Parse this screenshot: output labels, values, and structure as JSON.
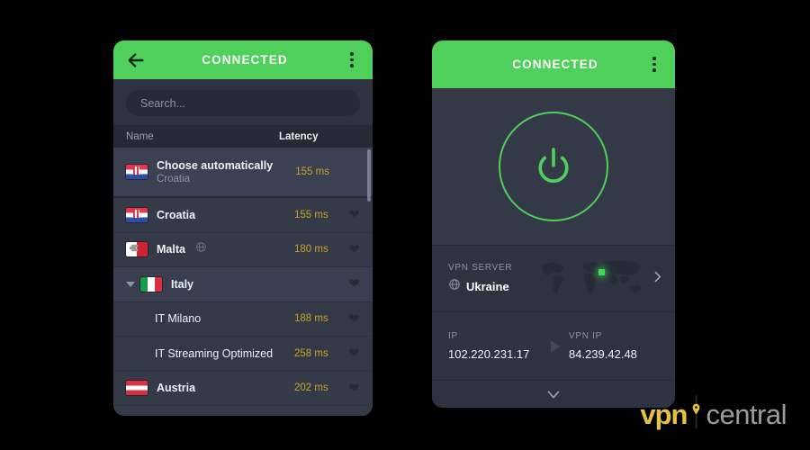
{
  "app": {
    "accent_green": "#4ed05a",
    "panel_bg": "#2f3341",
    "list_bg": "#353a49",
    "latency_color": "#c9a227"
  },
  "left_panel": {
    "header": {
      "title": "CONNECTED",
      "back_icon": "arrow-left-icon",
      "menu_icon": "kebab-menu-icon"
    },
    "search": {
      "placeholder": "Search...",
      "value": ""
    },
    "columns": {
      "name": "Name",
      "latency": "Latency"
    },
    "rows": [
      {
        "title": "Choose automatically",
        "subtitle": "Croatia",
        "latency": "155 ms",
        "flag": "hr",
        "type": "auto",
        "favorite": false,
        "virtual": false
      },
      {
        "title": "Croatia",
        "subtitle": "",
        "latency": "155 ms",
        "flag": "hr",
        "type": "country",
        "favorite": false,
        "virtual": false
      },
      {
        "title": "Malta",
        "subtitle": "",
        "latency": "180 ms",
        "flag": "mt",
        "type": "country",
        "favorite": false,
        "virtual": true
      },
      {
        "title": "Italy",
        "subtitle": "",
        "latency": "",
        "flag": "it",
        "type": "group-expanded",
        "favorite": false,
        "virtual": false
      },
      {
        "title": "IT Milano",
        "subtitle": "",
        "latency": "188 ms",
        "flag": "",
        "type": "child",
        "favorite": false,
        "virtual": false
      },
      {
        "title": "IT Streaming Optimized",
        "subtitle": "",
        "latency": "258 ms",
        "flag": "",
        "type": "child",
        "favorite": false,
        "virtual": false
      },
      {
        "title": "Austria",
        "subtitle": "",
        "latency": "202 ms",
        "flag": "at",
        "type": "country",
        "favorite": false,
        "virtual": false
      }
    ]
  },
  "right_panel": {
    "header": {
      "title": "CONNECTED",
      "menu_icon": "kebab-menu-icon"
    },
    "power": {
      "icon": "power-icon",
      "state": "on"
    },
    "server": {
      "label": "VPN SERVER",
      "name": "Ukraine",
      "virtual_icon": "globe-icon",
      "chevron": "chevron-right-icon"
    },
    "ip": {
      "label": "IP",
      "value": "102.220.231.17"
    },
    "vpn_ip": {
      "label": "VPN IP",
      "value": "84.239.42.48"
    },
    "expand": {
      "icon": "chevron-down-icon"
    }
  },
  "watermark": {
    "part1": "vpn",
    "part2": "central",
    "pin_icon": "location-pin-icon",
    "color1": "#e8c23a",
    "color2": "#9c9c9c"
  }
}
